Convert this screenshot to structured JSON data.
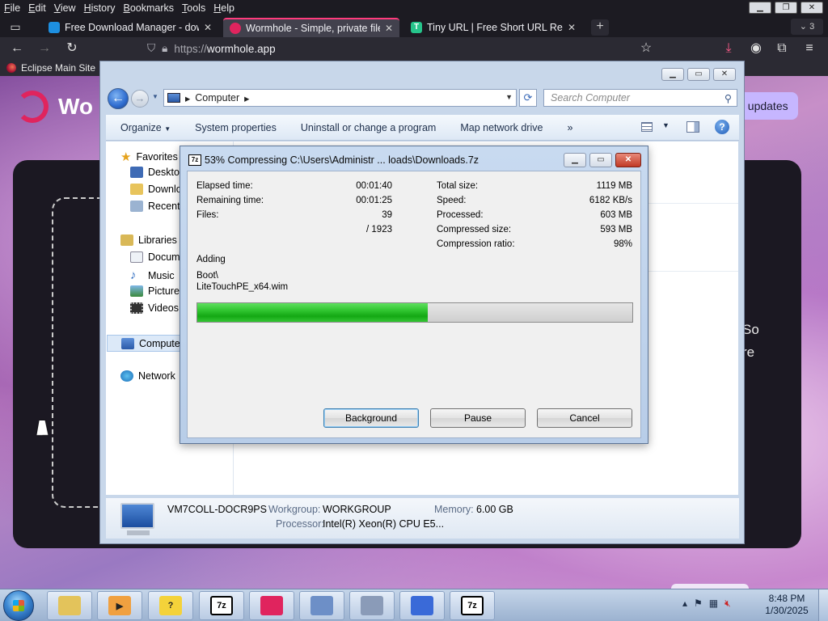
{
  "firefox": {
    "menu": [
      "File",
      "Edit",
      "View",
      "History",
      "Bookmarks",
      "Tools",
      "Help"
    ],
    "tabs": [
      {
        "title": "Free Download Manager - dowr",
        "favicon_color": "#1d8fe0"
      },
      {
        "title": "Wormhole - Simple, private file",
        "favicon_color": "#e0245e"
      },
      {
        "title": "Tiny URL | Free Short URL Redire",
        "favicon_color": "#26c48b"
      }
    ],
    "tab_count": "3",
    "url_scheme": "https://",
    "url_host": "wormhole.app",
    "bookmarks": [
      {
        "label": "Eclipse Main Site"
      }
    ]
  },
  "webpage": {
    "brand": "Wo",
    "update_button": "t updates",
    "side_text_1": "So",
    "side_text_2": "re"
  },
  "explorer": {
    "address": "Computer",
    "search_placeholder": "Search Computer",
    "toolbar": [
      "Organize",
      "System properties",
      "Uninstall or change a program",
      "Map network drive",
      "»"
    ],
    "nav": {
      "favorites": {
        "label": "Favorites",
        "items": [
          "Desktop",
          "Downlo",
          "Recent"
        ]
      },
      "libraries": {
        "label": "Libraries",
        "items": [
          "Docume",
          "Music",
          "Pictures",
          "Videos"
        ]
      },
      "computer": "Computer",
      "network": "Network"
    },
    "status": {
      "computer_name": "VM7COLL-DOCR9PS",
      "workgroup_label": "Workgroup:",
      "workgroup": "WORKGROUP",
      "memory_label": "Memory:",
      "memory": "6.00 GB",
      "processor_label": "Processor:",
      "processor": "Intel(R) Xeon(R) CPU E5..."
    }
  },
  "zip": {
    "app_icon": "7z",
    "title": "53% Compressing C:\\Users\\Administr ... loads\\Downloads.7z",
    "elapsed_label": "Elapsed time:",
    "elapsed": "00:01:40",
    "remaining_label": "Remaining time:",
    "remaining": "00:01:25",
    "files_label": "Files:",
    "files": "39",
    "files_total": "/ 1923",
    "total_size_label": "Total size:",
    "total_size": "1119 MB",
    "speed_label": "Speed:",
    "speed": "6182 KB/s",
    "processed_label": "Processed:",
    "processed": "603 MB",
    "compressed_label": "Compressed size:",
    "compressed": "593 MB",
    "ratio_label": "Compression ratio:",
    "ratio": "98%",
    "status": "Adding",
    "file_line1": "Boot\\",
    "file_line2": "LiteTouchPE_x64.wim",
    "progress_fraction": 0.53,
    "buttons": {
      "background": "Background",
      "pause": "Pause",
      "cancel": "Cancel"
    }
  },
  "taskbar": {
    "items": [
      {
        "icon": "explorer-folder-icon",
        "glyph": "",
        "color": "#e3c35b"
      },
      {
        "icon": "media-player-icon",
        "glyph": "▶",
        "color": "#f0a040"
      },
      {
        "icon": "help-icon",
        "glyph": "?",
        "color": "#f4d23a"
      },
      {
        "icon": "7zip-icon",
        "glyph": "7z",
        "color": "#ffffff"
      },
      {
        "icon": "wormhole-app-icon",
        "glyph": "",
        "color": "#e0245e"
      },
      {
        "icon": "network-computers-icon",
        "glyph": "",
        "color": "#6d8fc7"
      },
      {
        "icon": "control-panel-icon",
        "glyph": "",
        "color": "#8a9bb8"
      },
      {
        "icon": "bird-app-icon",
        "glyph": "",
        "color": "#3a6ad8"
      },
      {
        "icon": "7zip-active-icon",
        "glyph": "7z",
        "color": "#ffffff"
      }
    ],
    "time": "8:48 PM",
    "date": "1/30/2025"
  }
}
